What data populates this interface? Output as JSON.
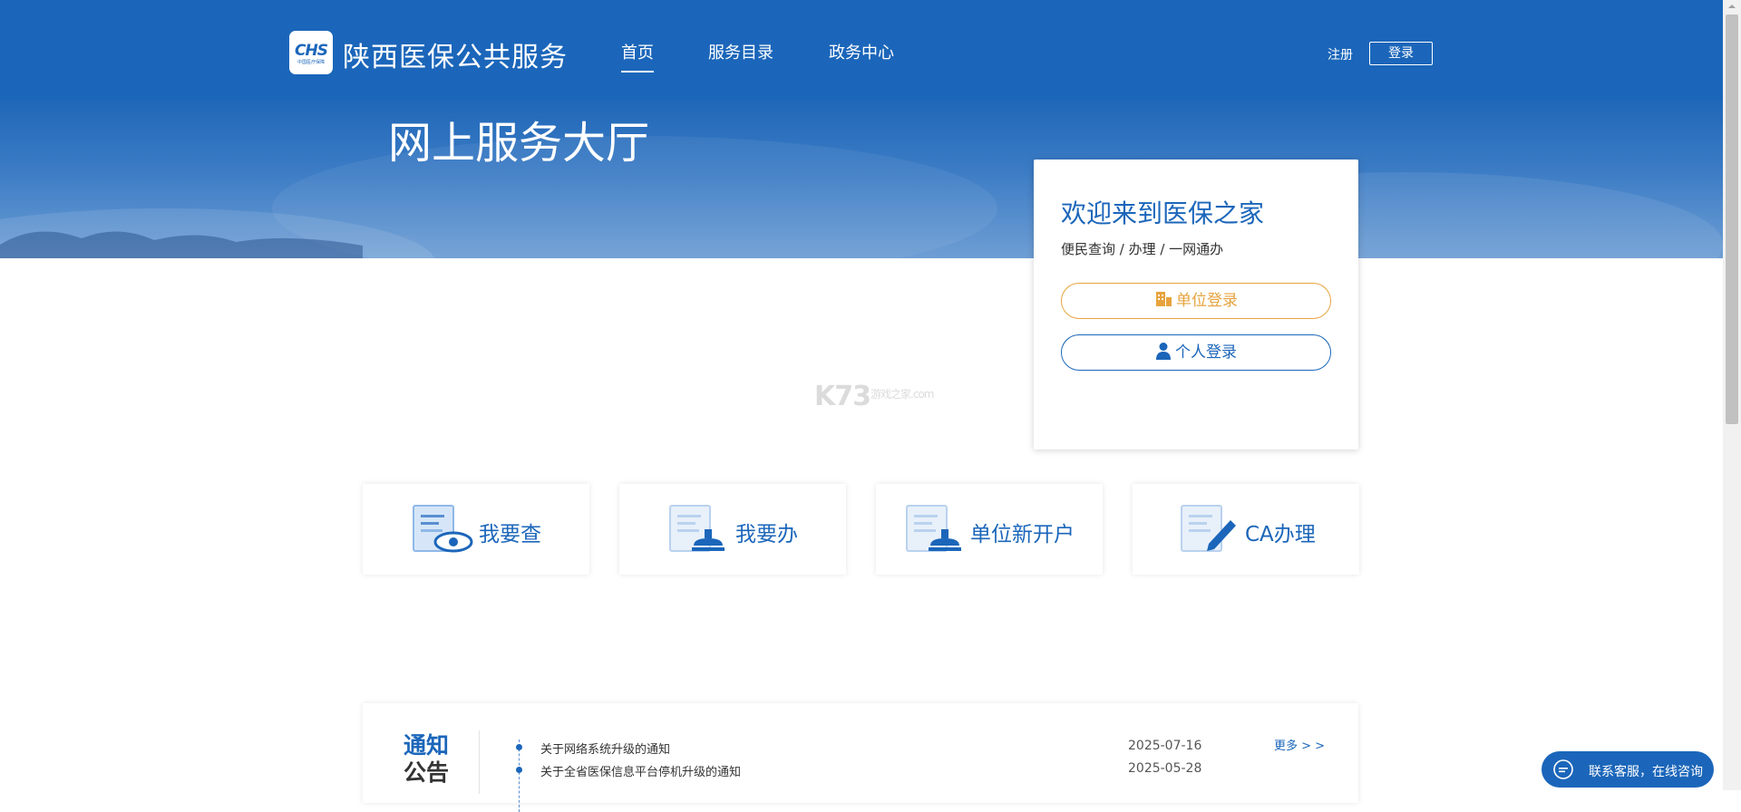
{
  "header": {
    "logo_mark": "CHS",
    "logo_sub": "中国医疗保障",
    "site_title": "陕西医保公共服务",
    "nav": [
      {
        "label": "首页",
        "active": true
      },
      {
        "label": "服务目录",
        "active": false
      },
      {
        "label": "政务中心",
        "active": false
      }
    ],
    "register_label": "注册",
    "login_label": "登录"
  },
  "banner": {
    "title": "网上服务大厅"
  },
  "login_card": {
    "title": "欢迎来到医保之家",
    "subtitle": "便民查询 / 办理 / 一网通办",
    "unit_login_label": "单位登录",
    "person_login_label": "个人登录"
  },
  "watermark": {
    "text": "K73",
    "sub": "游戏之家.com"
  },
  "services": [
    {
      "label": "我要查",
      "icon": "search-document-icon"
    },
    {
      "label": "我要办",
      "icon": "stamp-document-icon"
    },
    {
      "label": "单位新开户",
      "icon": "stamp-document-icon"
    },
    {
      "label": "CA办理",
      "icon": "pen-document-icon"
    }
  ],
  "notice": {
    "heading_line1": "通知",
    "heading_line2": "公告",
    "more_label": "更多 > >",
    "items": [
      {
        "title": "关于网络系统升级的通知",
        "date": "2025-07-16"
      },
      {
        "title": "关于全省医保信息平台停机升级的通知",
        "date": "2025-05-28"
      }
    ]
  },
  "chat": {
    "label": "联系客服，在线咨询"
  },
  "colors": {
    "primary": "#1b66ba",
    "unit_accent": "#e7a33e"
  }
}
